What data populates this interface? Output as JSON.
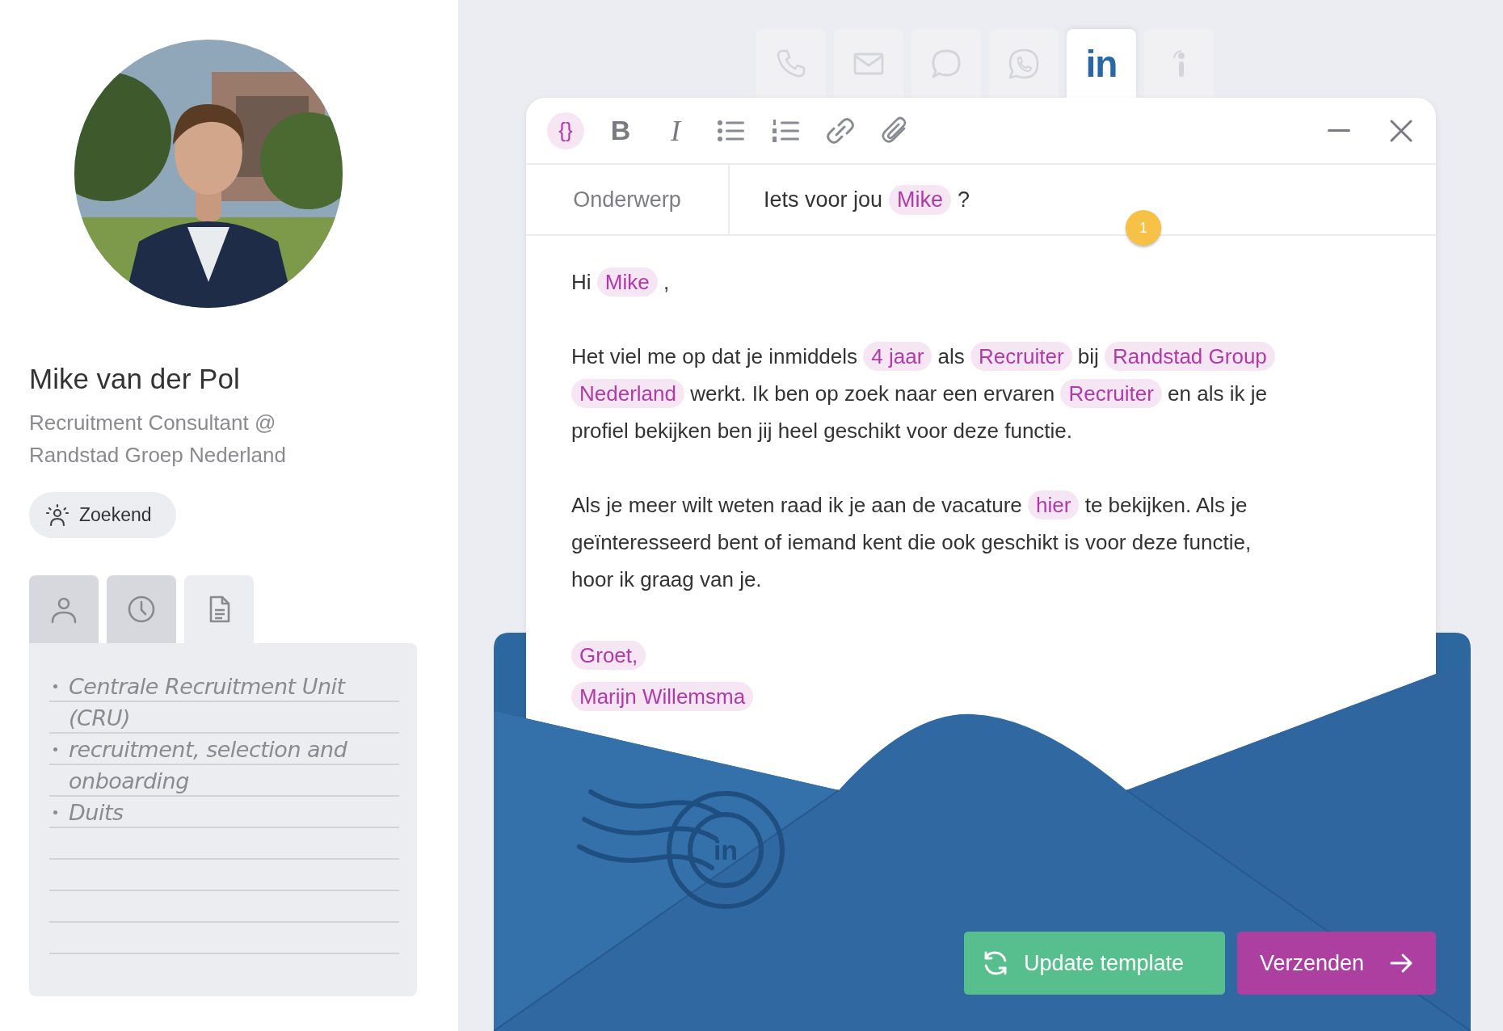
{
  "profile": {
    "kind": "picture",
    "name": "Mike van der Pol",
    "headline": "Recruitment Consultant @ Randstad Groep Nederland",
    "status": "Zoekend"
  },
  "profile_tabs": [
    {
      "kind": "person",
      "selected": false
    },
    {
      "kind": "history",
      "selected": false
    },
    {
      "kind": "notes",
      "selected": true
    }
  ],
  "notes": [
    {
      "text": "Centrale Recruitment Unit (CRU)"
    },
    {
      "text": "recruitment, selection and onboarding"
    },
    {
      "text": "Duits"
    }
  ],
  "channels": [
    {
      "kind": "phone",
      "selected": false
    },
    {
      "kind": "mail",
      "selected": false
    },
    {
      "kind": "chat",
      "selected": false
    },
    {
      "kind": "whatsapp",
      "selected": false
    },
    {
      "kind": "linkedin",
      "label": "in",
      "selected": true
    },
    {
      "kind": "info",
      "selected": false
    }
  ],
  "toolbar": [
    {
      "kind": "variable",
      "label": "{}",
      "active": true
    },
    {
      "kind": "bold",
      "label": "B",
      "active": false
    },
    {
      "kind": "italic",
      "label": "I",
      "active": false
    },
    {
      "kind": "bullets",
      "active": false
    },
    {
      "kind": "numbered",
      "active": false
    },
    {
      "kind": "link",
      "active": false
    },
    {
      "kind": "attach",
      "active": false
    }
  ],
  "subject": {
    "label": "Onderwerp",
    "segments": [
      {
        "kind": "text",
        "text": "Iets voor jou"
      },
      {
        "kind": "token",
        "text": "Mike"
      },
      {
        "kind": "text",
        "text": "?"
      }
    ],
    "badge": "1"
  },
  "body": [
    {
      "lines": [
        [
          {
            "kind": "text",
            "text": "Hi"
          },
          {
            "kind": "token",
            "text": "Mike"
          },
          {
            "kind": "text",
            "text": ","
          }
        ]
      ]
    },
    {
      "lines": [
        [
          {
            "kind": "text",
            "text": "Het viel me op dat je inmiddels"
          },
          {
            "kind": "token",
            "text": "4 jaar"
          },
          {
            "kind": "text",
            "text": "als"
          },
          {
            "kind": "token",
            "text": "Recruiter"
          },
          {
            "kind": "text",
            "text": "bij"
          },
          {
            "kind": "token",
            "text": "Randstad Group"
          }
        ],
        [
          {
            "kind": "token",
            "text": "Nederland"
          },
          {
            "kind": "text",
            "text": "werkt. Ik ben op zoek naar een ervaren"
          },
          {
            "kind": "token",
            "text": "Recruiter"
          },
          {
            "kind": "text",
            "text": "en als ik je"
          }
        ],
        [
          {
            "kind": "text",
            "text": "profiel bekijken ben jij heel geschikt voor deze functie."
          }
        ]
      ]
    },
    {
      "lines": [
        [
          {
            "kind": "text",
            "text": "Als je meer wilt weten raad ik je aan de vacature"
          },
          {
            "kind": "token",
            "text": "hier"
          },
          {
            "kind": "text",
            "text": "te bekijken. Als je"
          }
        ],
        [
          {
            "kind": "text",
            "text": "geïnteresseerd bent of iemand kent die ook geschikt is voor deze functie,"
          }
        ],
        [
          {
            "kind": "text",
            "text": "hoor ik graag van je."
          }
        ]
      ]
    },
    {
      "lines": [
        [
          {
            "kind": "token",
            "text": "Groet,"
          }
        ],
        [
          {
            "kind": "token",
            "text": "Marijn Willemsma"
          }
        ]
      ]
    }
  ],
  "stamp": {
    "label": "in"
  },
  "actions": [
    {
      "kind": "update",
      "label": "Update template"
    },
    {
      "kind": "send",
      "label": "Verzenden"
    }
  ]
}
